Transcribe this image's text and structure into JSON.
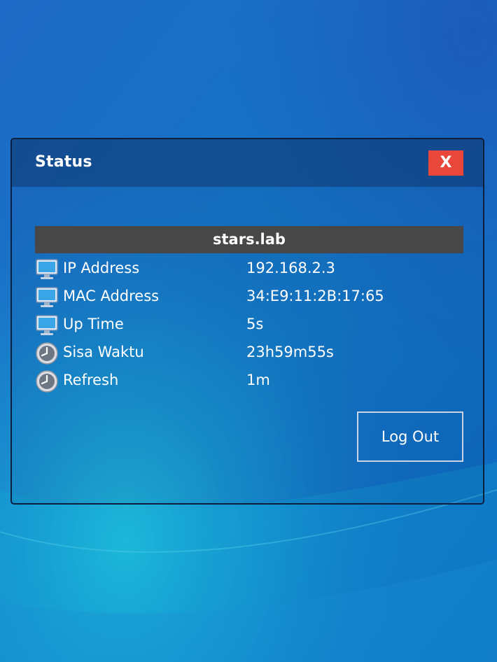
{
  "dialog": {
    "title": "Status",
    "close_label": "X",
    "hostname": "stars.lab",
    "rows": [
      {
        "icon": "monitor-icon",
        "label": "IP Address",
        "value": "192.168.2.3"
      },
      {
        "icon": "monitor-icon",
        "label": "MAC Address",
        "value": "34:E9:11:2B:17:65"
      },
      {
        "icon": "monitor-icon",
        "label": "Up Time",
        "value": "5s"
      },
      {
        "icon": "clock-icon",
        "label": "Sisa Waktu",
        "value": "23h59m55s"
      },
      {
        "icon": "clock-icon",
        "label": "Refresh",
        "value": "1m"
      }
    ],
    "logout_label": "Log Out"
  },
  "colors": {
    "close_button": "#e8473a",
    "host_bar": "#474747",
    "background": "#1a6cc4"
  }
}
